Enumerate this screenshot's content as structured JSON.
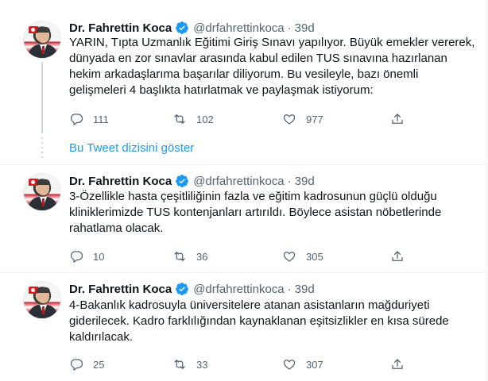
{
  "author": {
    "name": "Dr. Fahrettin Koca",
    "handle": "@drfahrettinkoca",
    "separator": "·",
    "time": "39d"
  },
  "colors": {
    "accent": "#1d9bf0",
    "text": "#0f1419",
    "muted": "#536471"
  },
  "tweets": [
    {
      "lines": [
        "YARIN, Tıpta Uzmanlık Eğitimi Giriş Sınavı yapılıyor. Büyük emekler vererek,",
        "dünyada en zor sınavlar arasında kabul edilen TUS sınavına hazırlanan",
        "hekim arkadaşlarıma başarılar diliyorum. Bu vesileyle, bazı önemli",
        "gelişmeleri 4 başlıkta hatırlatmak ve paylaşmak istiyorum:"
      ],
      "replies": "111",
      "retweets": "102",
      "likes": "977"
    },
    {
      "lines": [
        "3-Özellikle hasta çeşitliliğinin fazla ve eğitim kadrosunun güçlü olduğu",
        "kliniklerimizde TUS kontenjanları artırıldı. Böylece asistan nöbetlerinde",
        "rahatlama olacak."
      ],
      "replies": "10",
      "retweets": "36",
      "likes": "305"
    },
    {
      "lines": [
        "4-Bakanlık kadrosuyla üniversitelere atanan asistanların mağduriyeti",
        "giderilecek. Kadro farklılığından kaynaklanan eşitsizlikler en kısa sürede",
        "kaldırılacak."
      ],
      "replies": "25",
      "retweets": "33",
      "likes": "307"
    }
  ],
  "show_thread_label": "Bu Tweet dizisini göster",
  "icons": [
    "verified-icon",
    "reply-icon",
    "retweet-icon",
    "like-icon",
    "share-icon"
  ]
}
